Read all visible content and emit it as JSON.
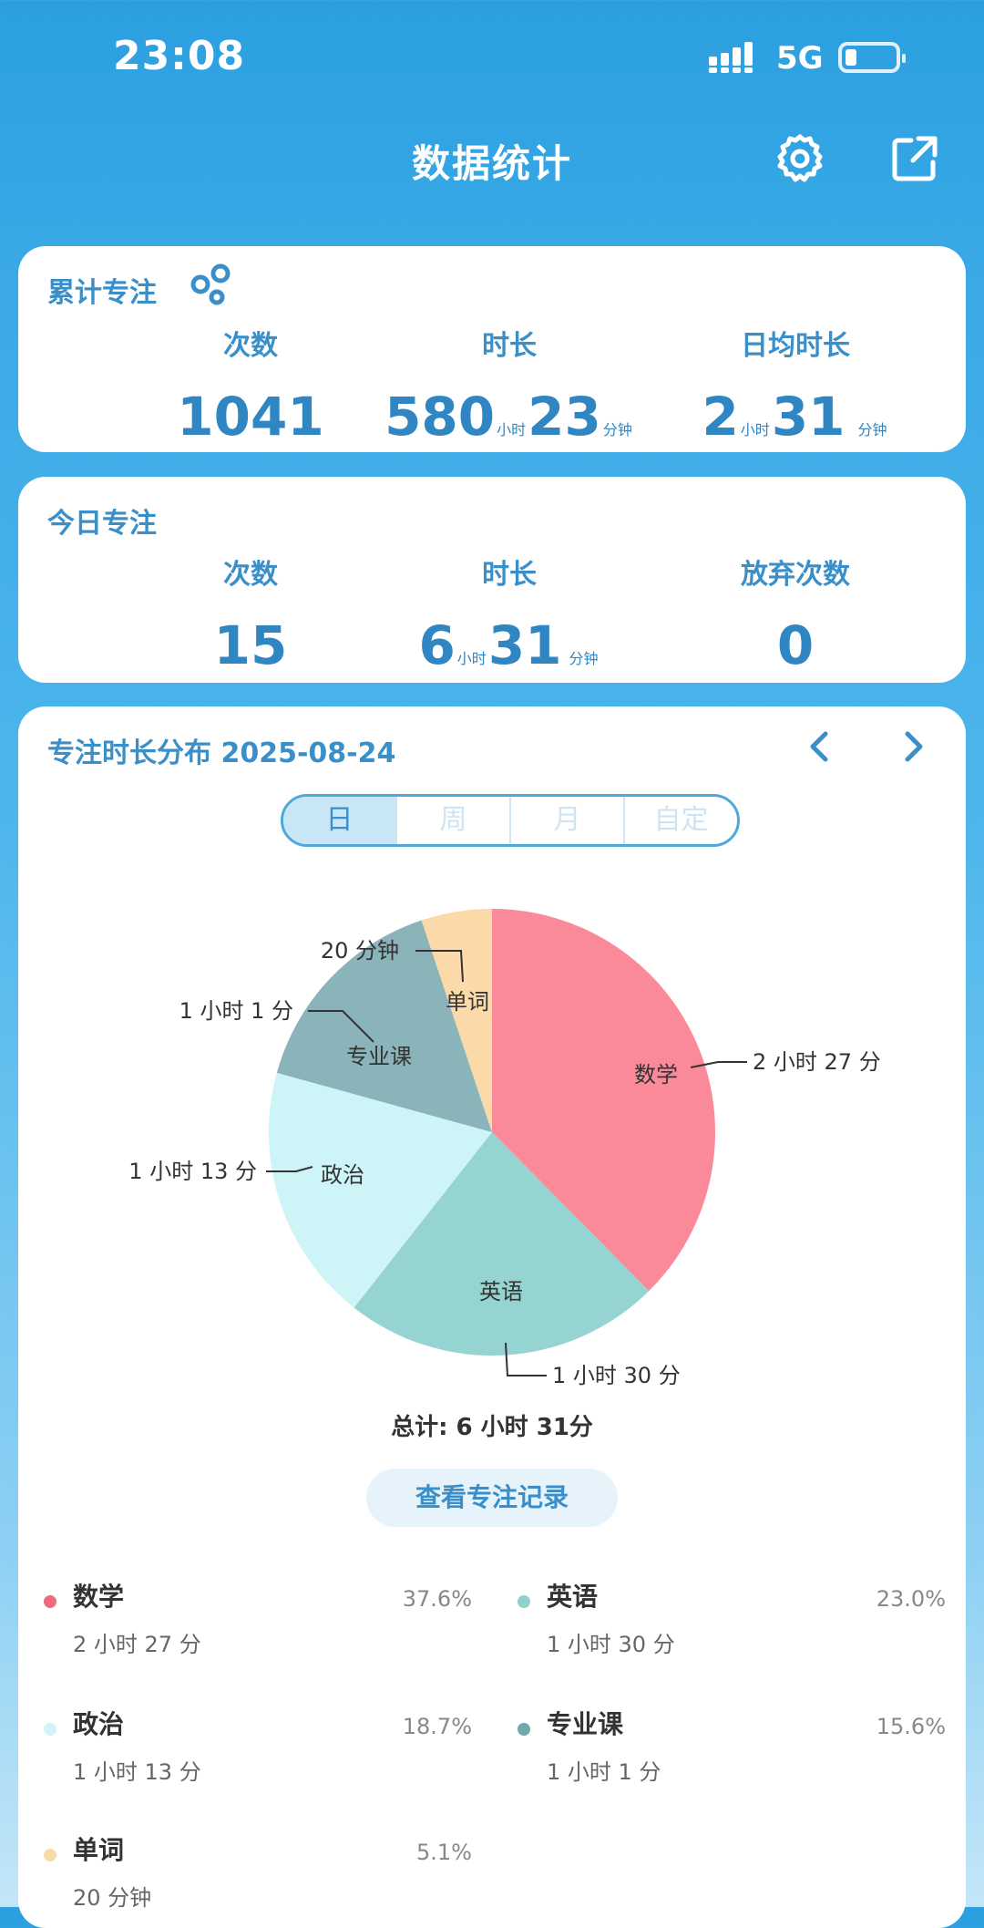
{
  "status": {
    "time": "23:08",
    "network": "5G"
  },
  "header": {
    "title": "数据统计",
    "settings_icon": "gear-icon",
    "share_icon": "export-icon"
  },
  "cumulative": {
    "title": "累计专注",
    "count_label": "次数",
    "count": "1041",
    "duration_label": "时长",
    "duration_hours": "580",
    "duration_minutes": "23",
    "avg_label": "日均时长",
    "avg_hours": "2",
    "avg_minutes": "31",
    "unit_hour": "小时",
    "unit_minute": "分钟"
  },
  "today": {
    "title": "今日专注",
    "count_label": "次数",
    "count": "15",
    "duration_label": "时长",
    "duration_hours": "6",
    "duration_minutes": "31",
    "abandon_label": "放弃次数",
    "abandon": "0"
  },
  "distribution": {
    "title": "专注时长分布 2025-08-24",
    "tabs": [
      "日",
      "周",
      "月",
      "自定"
    ],
    "selected_tab": "日",
    "total": "总计: 6 小时 31分",
    "record_button": "查看专注记录"
  },
  "chart_data": {
    "type": "pie",
    "categories": [
      "数学",
      "英语",
      "政治",
      "专业课",
      "单词"
    ],
    "values": [
      147,
      90,
      73,
      61,
      20
    ],
    "value_labels": [
      "2 小时 27 分",
      "1 小时 30 分",
      "1 小时 13 分",
      "1 小时 1 分",
      "20 分钟"
    ],
    "colors": [
      "#fa8a9a",
      "#96d4d2",
      "#cdf4f7",
      "#8ab3ba",
      "#fbd9a8"
    ]
  },
  "legend": [
    {
      "name": "数学",
      "duration": "2 小时 27 分",
      "percent": "37.6%",
      "color": "#ef6a7d"
    },
    {
      "name": "英语",
      "duration": "1 小时 30 分",
      "percent": "23.0%",
      "color": "#8fd1ce"
    },
    {
      "name": "政治",
      "duration": "1 小时 13 分",
      "percent": "18.7%",
      "color": "#d3f3f8"
    },
    {
      "name": "专业课",
      "duration": "1 小时 1 分",
      "percent": "15.6%",
      "color": "#6fa9ac"
    },
    {
      "name": "单词",
      "duration": "20 分钟",
      "percent": "5.1%",
      "color": "#f8dba8"
    }
  ]
}
